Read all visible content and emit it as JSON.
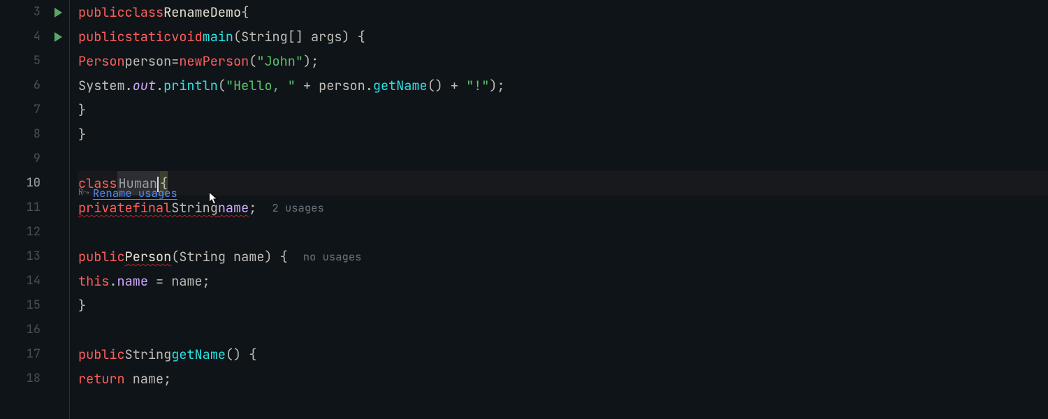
{
  "gutter": {
    "lines": [
      "3",
      "4",
      "5",
      "6",
      "7",
      "8",
      "9",
      "10",
      "11",
      "12",
      "13",
      "14",
      "15",
      "16",
      "17",
      "18"
    ],
    "runLines": [
      0,
      1
    ],
    "currentLineIndex": 7
  },
  "hint": {
    "icon": "R⤳",
    "label": "Rename usages"
  },
  "usages": {
    "name_field": "2 usages",
    "constructor": "no usages"
  },
  "code": {
    "l3": {
      "kw1": "public",
      "kw2": "class",
      "cls": "RenameDemo",
      "brace": "{"
    },
    "l4": {
      "kw1": "public",
      "kw2": "static",
      "kw3": "void",
      "fn": "main",
      "sig": "(String[] args) {"
    },
    "l5": {
      "typ1": "Person",
      "var": "person",
      "eq": "=",
      "kw": "new",
      "typ2": "Person",
      "open": "(",
      "str": "\"John\"",
      "close": ");"
    },
    "l6": {
      "sys": "System.",
      "out": "out",
      "dot": ".",
      "fn": "println",
      "open": "(",
      "s1": "\"Hello, \"",
      "plus1": " + ",
      "obj": "person.",
      "fn2": "getName",
      "paren": "()",
      "plus2": " + ",
      "s2": "\"!\"",
      "close": ");"
    },
    "l7": {
      "brace": "}"
    },
    "l8": {
      "brace": "}"
    },
    "l10": {
      "kw": "class",
      "name": "Human",
      "brace": "{"
    },
    "l11": {
      "kw1": "private",
      "kw2": "final",
      "typ": "String",
      "fld": "name",
      "semi": ";"
    },
    "l13": {
      "kw": "public",
      "ctor": "Person",
      "sig": "(String name) {"
    },
    "l14": {
      "kw": "this",
      "dot": ".",
      "fld": "name",
      "rest": " = name;"
    },
    "l15": {
      "brace": "}"
    },
    "l17": {
      "kw": "public",
      "typ": "String",
      "fn": "getName",
      "sig": "() {"
    },
    "l18": {
      "kw": "return",
      "rest": " name;"
    }
  }
}
